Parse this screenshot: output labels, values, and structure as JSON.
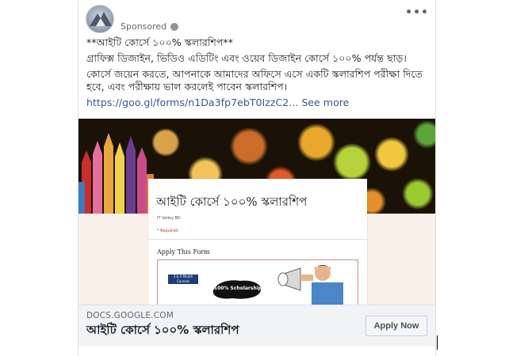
{
  "post": {
    "sponsored_label": "Sponsored ·",
    "more_label": "•••",
    "title_line": "**আইটি কোর্সে ১০০% স্কলারশিপ**",
    "body_line1": "গ্রাফিক্স ডিজাইন, ভিডিও এডিটিং এবং ওয়েব ডিজাইন কোর্সে ১০০% পর্যন্ত ছাড়।",
    "body_line2": "কোর্সে জয়েন করতে, আপনাকে আমাদের অফিসে এসে একটি স্কলারশিপ পরীক্ষা দিতে হবে, এবং পরীক্ষায় ভাল করলেই পাবেন স্কলারশিপ।",
    "link": "https://goo.gl/forms/n1Da3fp7ebT0IzzC2...",
    "see_more": "See more"
  },
  "image": {
    "form_title": "আইটি কোর্সে ১০০% স্কলারশিপ",
    "form_org": "IT Valley BD",
    "form_required": "* Required",
    "form_apply": "Apply This Form",
    "badge_text": "3 & 4 Month Courses",
    "scholarship_text": "100% Scholarship"
  },
  "footer": {
    "domain": "DOCS.GOOGLE.COM",
    "headline": "আইটি কোর্সে ১০০% স্কলারশিপ",
    "cta": "Apply Now"
  },
  "colors": {
    "link": "#385898",
    "muted": "#606770",
    "footer_bg": "#f2f3f5"
  }
}
